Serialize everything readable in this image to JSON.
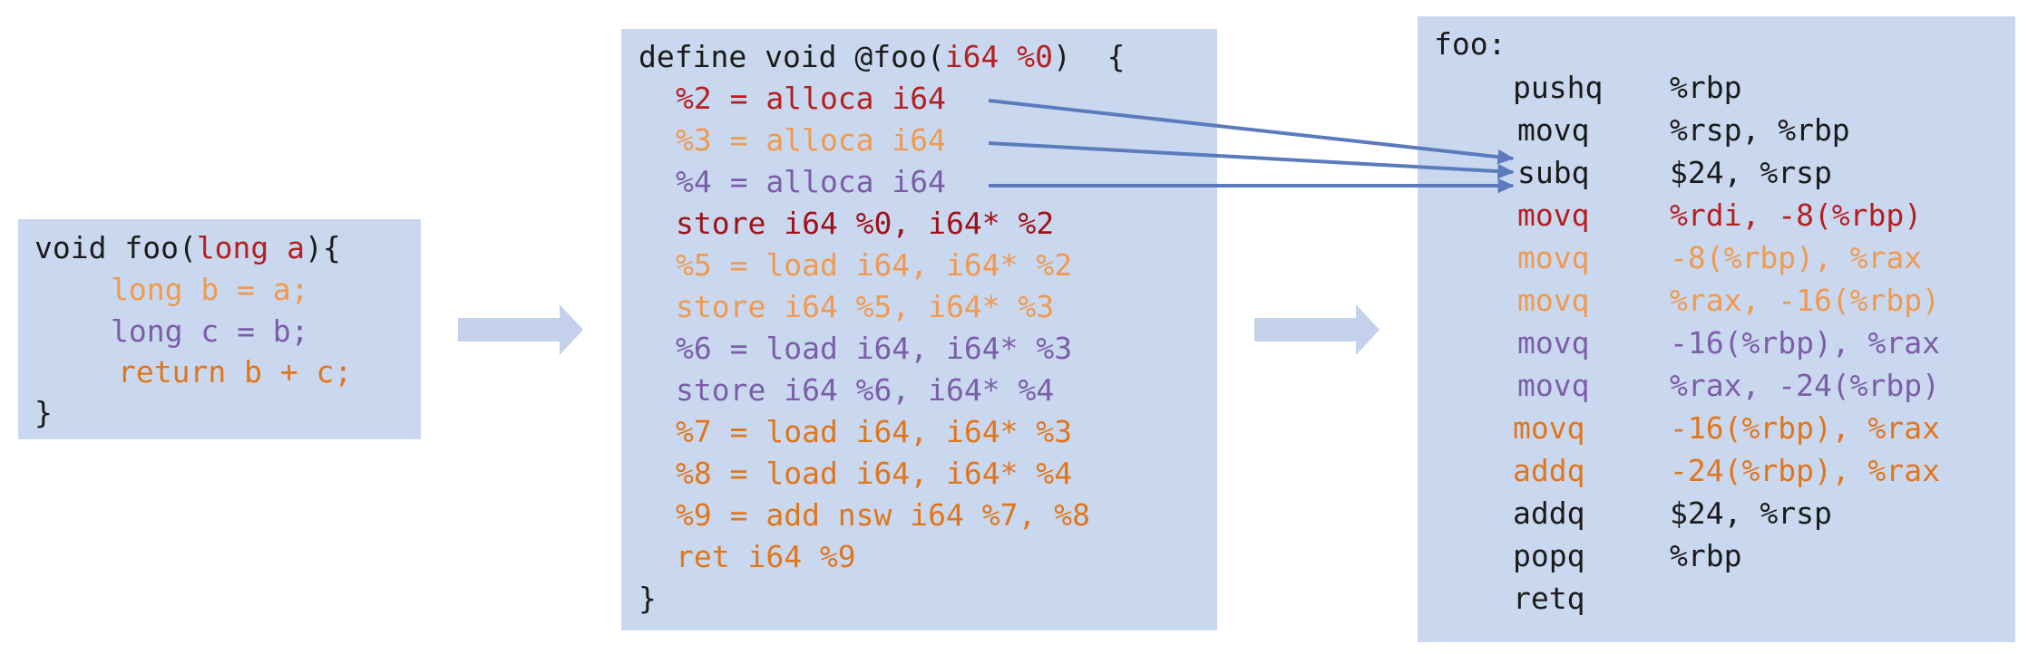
{
  "colors": {
    "panel": "#c9d8ef",
    "black": "#1a1a1a",
    "red": "#b51f1f",
    "peach": "#ef9a4f",
    "purple": "#7b5ea7",
    "orange": "#e0761c",
    "arrow": "#5b7bbd",
    "big_arrow": "#c3d2ea"
  },
  "c_code": {
    "l1_a": "void foo(",
    "l1_b": "long a",
    "l1_c": "){",
    "l2": "long b = a;",
    "l3": "long c = b;",
    "l4": "return b + c;",
    "l5": "}"
  },
  "ir_code": {
    "l1_a": "define void @foo(",
    "l1_b": "i64 %0",
    "l1_c": ")  {",
    "l2": "%2 = alloca i64",
    "l3": "%3 = alloca i64",
    "l4": "%4 = alloca i64",
    "l5": "store i64 %0, i64* %2",
    "l6": "%5 = load i64, i64* %2",
    "l7": "store i64 %5, i64* %3",
    "l8": "%6 = load i64, i64* %3",
    "l9": "store i64 %6, i64* %4",
    "l10": "%7 = load i64, i64* %3",
    "l11": "%8 = load i64, i64* %4",
    "l12": "%9 = add nsw i64 %7, %8",
    "l13": "ret i64 %9",
    "l14": "}"
  },
  "asm_code": {
    "label": "foo:",
    "rows": [
      {
        "mn": "pushq",
        "op": "%rbp"
      },
      {
        "mn": "movq",
        "op": "%rsp, %rbp"
      },
      {
        "mn": "subq",
        "op": "$24, %rsp"
      },
      {
        "mn": "movq",
        "op": "%rdi, -8(%rbp)"
      },
      {
        "mn": "movq",
        "op": "-8(%rbp), %rax"
      },
      {
        "mn": "movq",
        "op": "%rax, -16(%rbp)"
      },
      {
        "mn": "movq",
        "op": "-16(%rbp), %rax"
      },
      {
        "mn": "movq",
        "op": "%rax, -24(%rbp)"
      },
      {
        "mn": "movq",
        "op": "-16(%rbp), %rax"
      },
      {
        "mn": "addq",
        "op": "-24(%rbp), %rax"
      },
      {
        "mn": "addq",
        "op": "$24, %rsp"
      },
      {
        "mn": "popq",
        "op": "%rbp"
      },
      {
        "mn": "retq",
        "op": ""
      }
    ]
  }
}
